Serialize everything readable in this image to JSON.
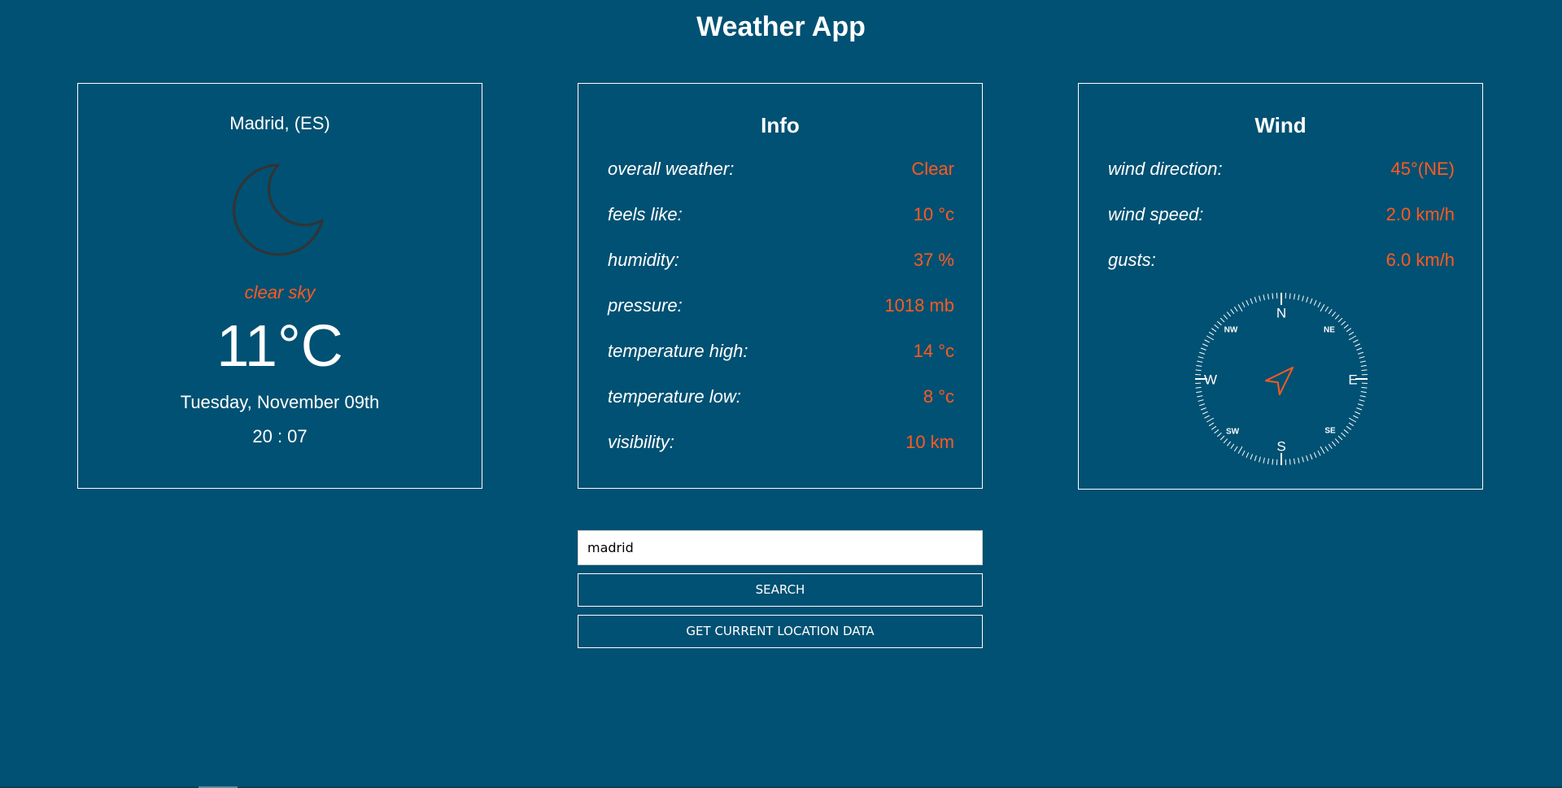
{
  "app": {
    "title": "Weather App"
  },
  "current": {
    "location": "Madrid, (ES)",
    "icon": "moon-icon",
    "description": "clear sky",
    "temperature": "11°C",
    "date": "Tuesday, November 09th",
    "time": "20 : 07"
  },
  "info": {
    "heading": "Info",
    "rows": [
      {
        "label": "overall weather:",
        "value": "Clear"
      },
      {
        "label": "feels like:",
        "value": "10 °c"
      },
      {
        "label": "humidity:",
        "value": "37 %"
      },
      {
        "label": "pressure:",
        "value": "1018 mb"
      },
      {
        "label": "temperature high:",
        "value": "14 °c"
      },
      {
        "label": "temperature low:",
        "value": "8 °c"
      },
      {
        "label": "visibility:",
        "value": "10 km"
      }
    ]
  },
  "wind": {
    "heading": "Wind",
    "rows": [
      {
        "label": "wind direction:",
        "value": "45°(NE)"
      },
      {
        "label": "wind speed:",
        "value": "2.0 km/h"
      },
      {
        "label": "gusts:",
        "value": "6.0 km/h"
      }
    ],
    "compass": {
      "direction_deg": 45,
      "cardinals": {
        "n": "N",
        "e": "E",
        "s": "S",
        "w": "W"
      },
      "intercardinals": {
        "ne": "NE",
        "se": "SE",
        "sw": "SW",
        "nw": "NW"
      }
    }
  },
  "search": {
    "value": "madrid",
    "search_label": "SEARCH",
    "location_label": "GET CURRENT LOCATION DATA"
  },
  "colors": {
    "background": "#005173",
    "accent": "#ff5a1f",
    "text": "#ffffff"
  }
}
